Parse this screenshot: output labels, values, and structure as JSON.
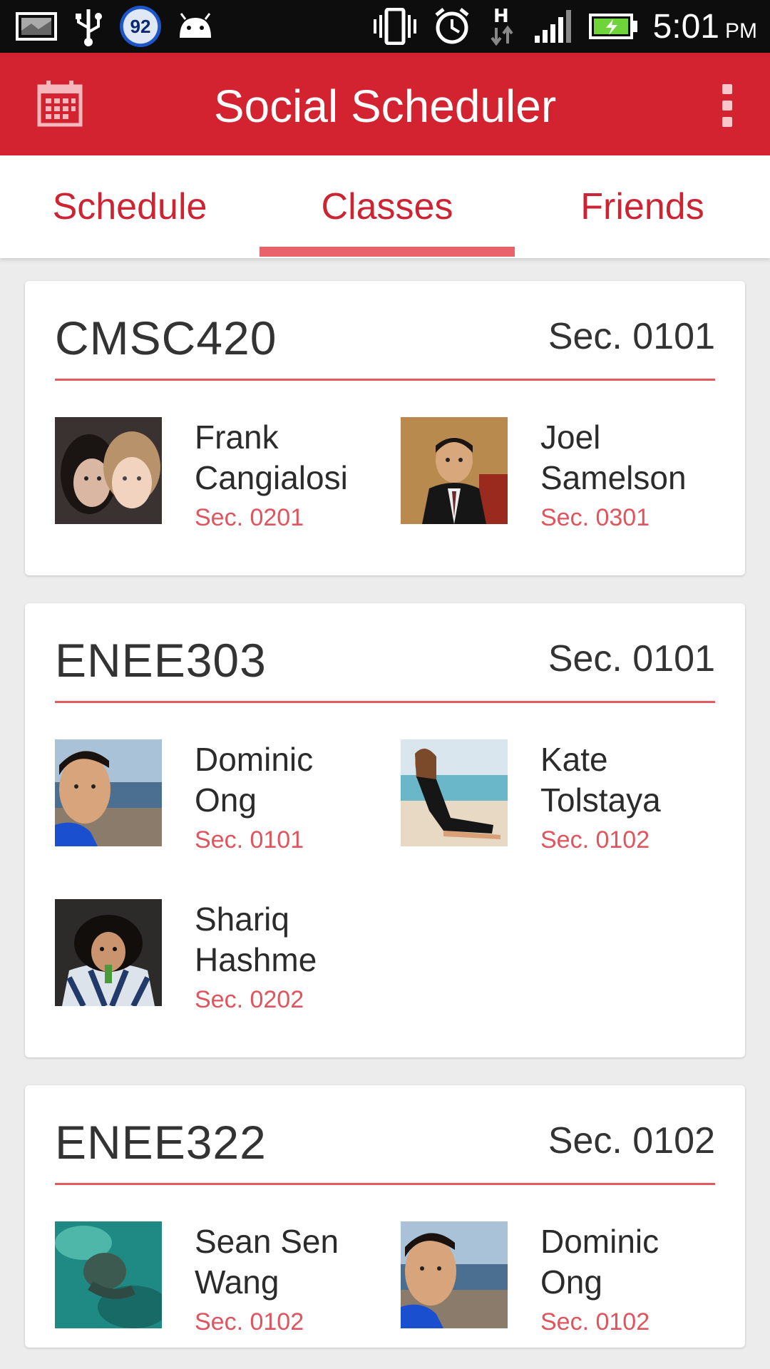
{
  "status_bar": {
    "battery_badge": "92",
    "time": "5:01",
    "ampm": "PM",
    "network_type": "H",
    "icons": [
      "gallery-icon",
      "usb-icon",
      "battery-saver-icon",
      "android-icon",
      "vibrate-icon",
      "alarm-icon",
      "data-icon",
      "signal-icon",
      "battery-charging-icon"
    ]
  },
  "app_bar": {
    "title": "Social Scheduler",
    "left_icon": "calendar-icon",
    "right_icon": "overflow-menu-icon"
  },
  "tabs": [
    {
      "label": "Schedule",
      "active": false
    },
    {
      "label": "Classes",
      "active": true
    },
    {
      "label": "Friends",
      "active": false
    }
  ],
  "classes": [
    {
      "code": "CMSC420",
      "section": "Sec. 0101",
      "friends": [
        {
          "first": "Frank",
          "last": "Cangialosi",
          "section": "Sec. 0201"
        },
        {
          "first": "Joel",
          "last": "Samelson",
          "section": "Sec. 0301"
        }
      ]
    },
    {
      "code": "ENEE303",
      "section": "Sec. 0101",
      "friends": [
        {
          "first": "Dominic",
          "last": "Ong",
          "section": "Sec. 0101"
        },
        {
          "first": "Kate",
          "last": "Tolstaya",
          "section": "Sec. 0102"
        },
        {
          "first": "Shariq",
          "last": "Hashme",
          "section": "Sec. 0202"
        }
      ]
    },
    {
      "code": "ENEE322",
      "section": "Sec. 0102",
      "friends": [
        {
          "first": "Sean Sen",
          "last": "Wang",
          "section": "Sec. 0102"
        },
        {
          "first": "Dominic",
          "last": "Ong",
          "section": "Sec. 0102"
        }
      ]
    }
  ],
  "colors": {
    "primary": "#d32330",
    "accent": "#e55a62",
    "tab_text": "#cc2433",
    "background": "#ececec"
  }
}
